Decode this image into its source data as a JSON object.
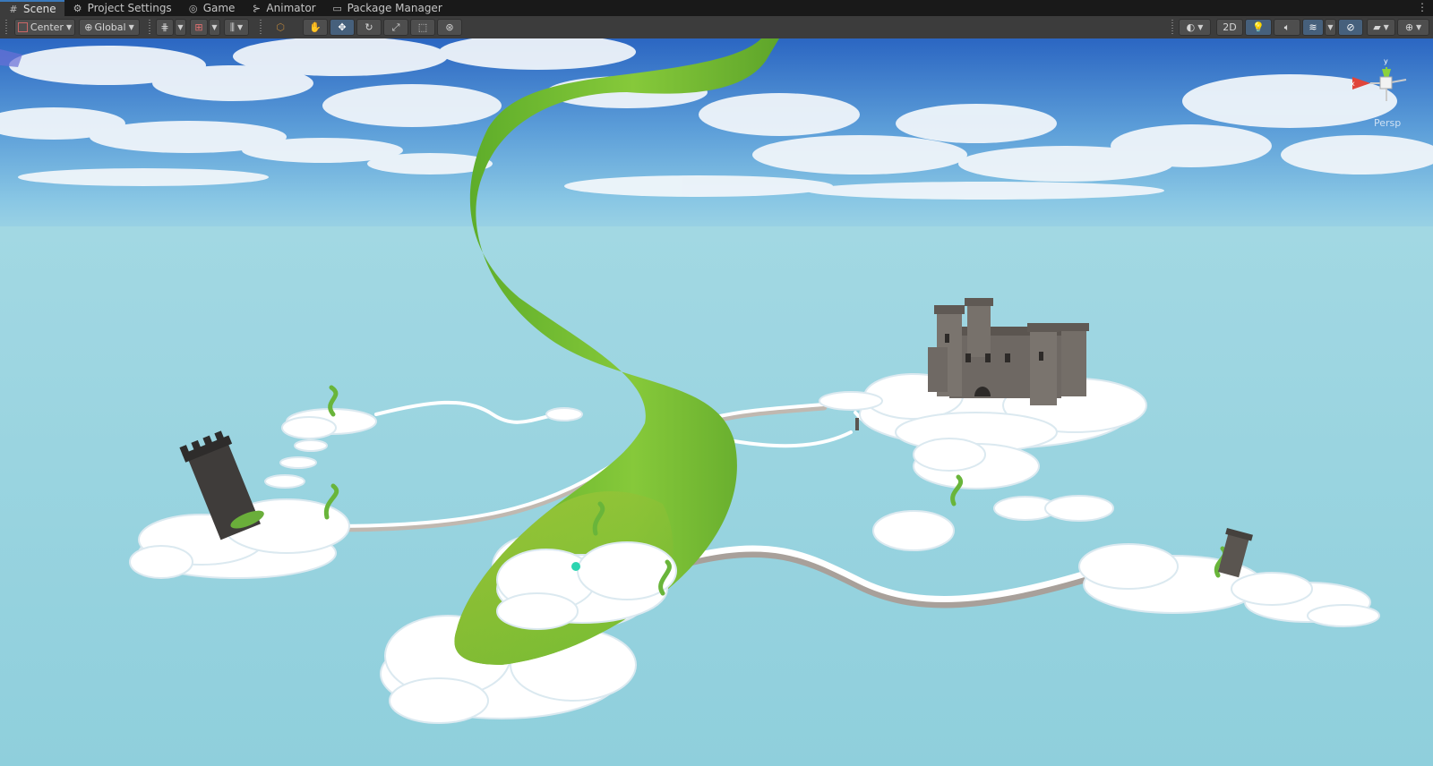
{
  "tabs": [
    {
      "label": "Scene",
      "icon": "grid-icon",
      "active": true
    },
    {
      "label": "Project Settings",
      "icon": "gear-icon",
      "active": false
    },
    {
      "label": "Game",
      "icon": "gamepad-icon",
      "active": false
    },
    {
      "label": "Animator",
      "icon": "animator-icon",
      "active": false
    },
    {
      "label": "Package Manager",
      "icon": "package-icon",
      "active": false
    }
  ],
  "toolbar": {
    "pivot_label": "Center",
    "space_label": "Global",
    "mode_2d_label": "2D",
    "tools": [
      "view-tool",
      "move-tool",
      "rotate-tool",
      "scale-tool",
      "rect-tool",
      "transform-tool"
    ],
    "active_tool": "move-tool",
    "accent": "#46607c"
  },
  "gizmo": {
    "projection_label": "Persp",
    "axis_colors": {
      "x": "#e0453a",
      "y": "#8ad13d",
      "z": "#4f7fd8"
    }
  },
  "scene": {
    "sky_top": "#2f6fc9",
    "horizon": "#9fd6e2",
    "ground": "#94d2de",
    "beanstalk_color": "#7cc336",
    "cloud_color": "#ffffff",
    "castle_color": "#6b6560"
  }
}
